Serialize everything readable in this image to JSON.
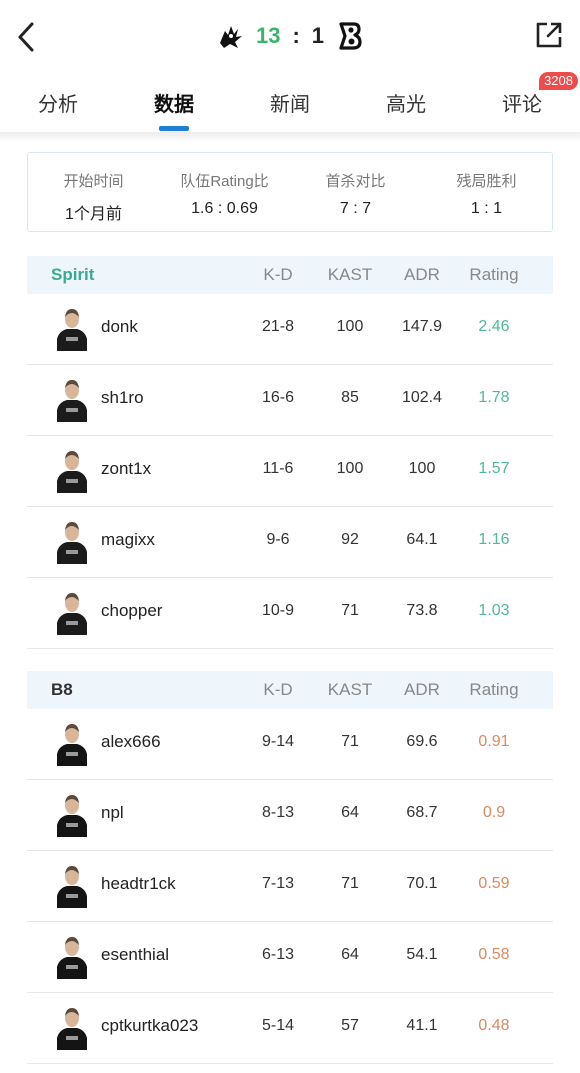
{
  "header": {
    "score_left": "13",
    "score_sep": ":",
    "score_right": "1",
    "score_left_color": "#3db46d",
    "icons": [
      "back-icon",
      "spirit-logo",
      "b8-logo",
      "share-icon"
    ]
  },
  "tabs": [
    {
      "label": "分析",
      "active": false
    },
    {
      "label": "数据",
      "active": true
    },
    {
      "label": "新闻",
      "active": false
    },
    {
      "label": "高光",
      "active": false
    },
    {
      "label": "评论",
      "active": false,
      "badge": "3208"
    }
  ],
  "summary": [
    {
      "label": "开始时间",
      "value": "1个月前"
    },
    {
      "label": "队伍Rating比",
      "value": "1.6 : 0.69"
    },
    {
      "label": "首杀对比",
      "value": "7 : 7"
    },
    {
      "label": "残局胜利",
      "value": "1 : 1"
    }
  ],
  "columns": {
    "kd": "K-D",
    "kast": "KAST",
    "adr": "ADR",
    "rating": "Rating"
  },
  "teams": [
    {
      "name": "Spirit",
      "name_color": "#3aab93",
      "rating_color": "#4fb89e",
      "jersey_color": "#1b1b1b",
      "players": [
        {
          "name": "donk",
          "kd": "21-8",
          "kast": "100",
          "adr": "147.9",
          "rating": "2.46"
        },
        {
          "name": "sh1ro",
          "kd": "16-6",
          "kast": "85",
          "adr": "102.4",
          "rating": "1.78"
        },
        {
          "name": "zont1x",
          "kd": "11-6",
          "kast": "100",
          "adr": "100",
          "rating": "1.57"
        },
        {
          "name": "magixx",
          "kd": "9-6",
          "kast": "92",
          "adr": "64.1",
          "rating": "1.16"
        },
        {
          "name": "chopper",
          "kd": "10-9",
          "kast": "71",
          "adr": "73.8",
          "rating": "1.03"
        }
      ]
    },
    {
      "name": "B8",
      "name_color": "#333333",
      "rating_color": "#d98a5f",
      "jersey_color": "#141414",
      "players": [
        {
          "name": "alex666",
          "kd": "9-14",
          "kast": "71",
          "adr": "69.6",
          "rating": "0.91"
        },
        {
          "name": "npl",
          "kd": "8-13",
          "kast": "64",
          "adr": "68.7",
          "rating": "0.9"
        },
        {
          "name": "headtr1ck",
          "kd": "7-13",
          "kast": "71",
          "adr": "70.1",
          "rating": "0.59"
        },
        {
          "name": "esenthial",
          "kd": "6-13",
          "kast": "64",
          "adr": "54.1",
          "rating": "0.58"
        },
        {
          "name": "cptkurtka023",
          "kd": "5-14",
          "kast": "57",
          "adr": "41.1",
          "rating": "0.48"
        }
      ]
    }
  ]
}
